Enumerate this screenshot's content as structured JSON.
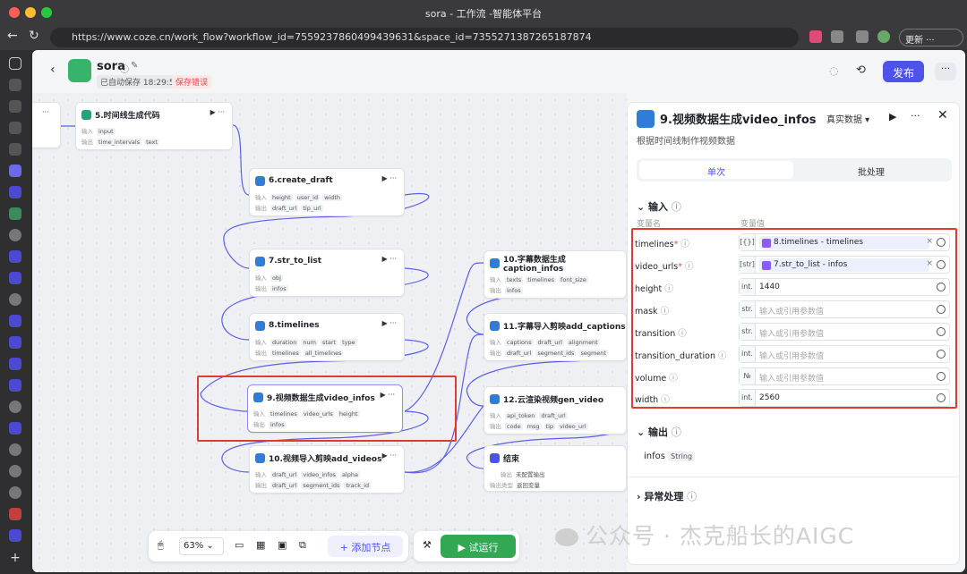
{
  "browser": {
    "tab_title": "sora - 工作流 -智能体平台",
    "url": "https://www.coze.cn/work_flow?workflow_id=7559237860499439631&space_id=7355271387265187874",
    "update_label": "更新"
  },
  "header": {
    "workflow_name": "sora",
    "autosave": "已自动保存 18:29:55",
    "save_error": "保存错误",
    "publish_label": "发布"
  },
  "canvas": {
    "zoom": "63%",
    "add_node_label": "添加节点",
    "test_run_label": "试运行",
    "nodes": [
      {
        "title": "5.时间线生成代码",
        "in_label": "输入",
        "in": [
          "input"
        ],
        "out_label": "输出",
        "out": [
          "time_intervals",
          "text"
        ]
      },
      {
        "title": "6.create_draft",
        "in_label": "输入",
        "in": [
          "height",
          "user_id",
          "width"
        ],
        "out_label": "输出",
        "out": [
          "draft_url",
          "tip_url"
        ]
      },
      {
        "title": "7.str_to_list",
        "in_label": "输入",
        "in": [
          "obj"
        ],
        "out_label": "输出",
        "out": [
          "infos"
        ]
      },
      {
        "title": "8.timelines",
        "in_label": "输入",
        "in": [
          "duration",
          "num",
          "start",
          "type"
        ],
        "out_label": "输出",
        "out": [
          "timelines",
          "all_timelines"
        ]
      },
      {
        "title": "9.视频数据生成video_infos",
        "in_label": "输入",
        "in": [
          "timelines",
          "video_urls",
          "height"
        ],
        "out_label": "输出",
        "out": [
          "infos"
        ]
      },
      {
        "title": "10.视频导入剪映add_videos",
        "in_label": "输入",
        "in": [
          "draft_url",
          "video_infos",
          "alpha"
        ],
        "out_label": "输出",
        "out": [
          "draft_url",
          "segment_ids",
          "track_id"
        ]
      },
      {
        "title": "10.字幕数据生成caption_infos",
        "in_label": "输入",
        "in": [
          "texts",
          "timelines",
          "font_size"
        ],
        "out_label": "输出",
        "out": [
          "infos"
        ]
      },
      {
        "title": "11.字幕导入剪映add_captions",
        "in_label": "输入",
        "in": [
          "captions",
          "draft_url",
          "alignment"
        ],
        "out_label": "输出",
        "out": [
          "draft_url",
          "segment_ids",
          "segment"
        ]
      },
      {
        "title": "12.云渲染视频gen_video",
        "in_label": "输入",
        "in": [
          "api_token",
          "draft_url"
        ],
        "out_label": "输出",
        "out": [
          "code",
          "msg",
          "tip",
          "video_url"
        ]
      },
      {
        "title": "结束",
        "in_label": "输出",
        "in": [
          "未配置输出"
        ],
        "out_label": "输出类型",
        "out": [
          "返回变量"
        ]
      }
    ]
  },
  "panel": {
    "title": "9.视频数据生成video_infos",
    "mode_label": "真实数据",
    "description": "根据时间线制作视频数据",
    "tab_single": "单次",
    "tab_batch": "批处理",
    "input_section": "输入",
    "col_name": "变量名",
    "col_value": "变量值",
    "params": [
      {
        "name": "timelines",
        "required": "*",
        "type": "[{}]",
        "value": "8.timelines - timelines",
        "is_ref": true
      },
      {
        "name": "video_urls",
        "required": "*",
        "type": "[str]",
        "value": "7.str_to_list - infos",
        "is_ref": true
      },
      {
        "name": "height",
        "required": "",
        "type": "int.",
        "value": "1440",
        "is_ref": false
      },
      {
        "name": "mask",
        "required": "",
        "type": "str.",
        "value": "输入或引用参数值",
        "is_ref": false,
        "placeholder": true
      },
      {
        "name": "transition",
        "required": "",
        "type": "str.",
        "value": "输入或引用参数值",
        "is_ref": false,
        "placeholder": true
      },
      {
        "name": "transition_duration",
        "required": "",
        "type": "int.",
        "value": "输入或引用参数值",
        "is_ref": false,
        "placeholder": true
      },
      {
        "name": "volume",
        "required": "",
        "type": "№",
        "value": "输入或引用参数值",
        "is_ref": false,
        "placeholder": true
      },
      {
        "name": "width",
        "required": "",
        "type": "int.",
        "value": "2560",
        "is_ref": false
      }
    ],
    "output_section": "输出",
    "output_name": "infos",
    "output_type": "String",
    "exception_section": "异常处理"
  },
  "watermark": "公众号 · 杰克船长的AIGC"
}
